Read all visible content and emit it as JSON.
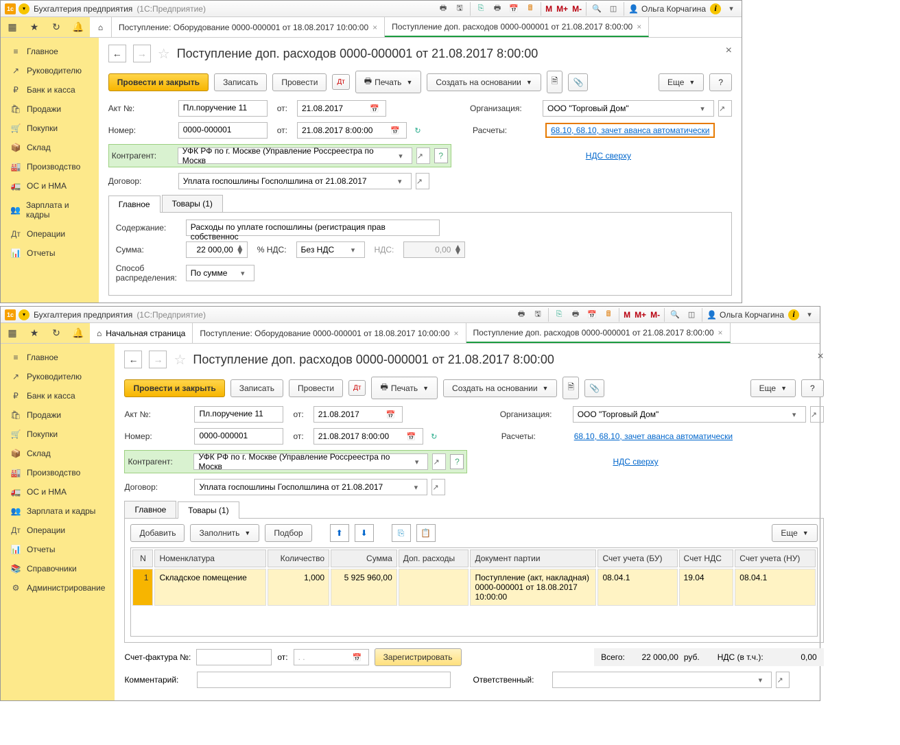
{
  "app": {
    "title": "Бухгалтерия предприятия",
    "subtitle": "(1С:Предприятие)",
    "user": "Ольга Корчагина"
  },
  "sidebar": {
    "items": [
      {
        "icon": "≡",
        "label": "Главное"
      },
      {
        "icon": "↗",
        "label": "Руководителю"
      },
      {
        "icon": "₽",
        "label": "Банк и касса"
      },
      {
        "icon": "🛍",
        "label": "Продажи"
      },
      {
        "icon": "🛒",
        "label": "Покупки"
      },
      {
        "icon": "📦",
        "label": "Склад"
      },
      {
        "icon": "🏭",
        "label": "Производство"
      },
      {
        "icon": "🚛",
        "label": "ОС и НМА"
      },
      {
        "icon": "👥",
        "label": "Зарплата и кадры"
      },
      {
        "icon": "Дт",
        "label": "Операции"
      },
      {
        "icon": "📊",
        "label": "Отчеты"
      },
      {
        "icon": "📚",
        "label": "Справочники"
      },
      {
        "icon": "⚙",
        "label": "Администрирование"
      }
    ]
  },
  "tabs": {
    "home": "Начальная страница",
    "t1": "Поступление: Оборудование 0000-000001 от 18.08.2017 10:00:00",
    "t2": "Поступление доп. расходов 0000-000001 от 21.08.2017 8:00:00"
  },
  "page": {
    "title": "Поступление доп. расходов 0000-000001 от 21.08.2017 8:00:00"
  },
  "toolbar": {
    "post_close": "Провести и закрыть",
    "write": "Записать",
    "post": "Провести",
    "print": "Печать",
    "create_based": "Создать на основании",
    "more": "Еще",
    "help": "?"
  },
  "fields": {
    "act_lbl": "Акт №:",
    "act_val": "Пл.поручение 11",
    "from_lbl": "от:",
    "act_date": "21.08.2017",
    "num_lbl": "Номер:",
    "num_val": "0000-000001",
    "num_date": "21.08.2017  8:00:00",
    "org_lbl": "Организация:",
    "org_val": "ООО \"Торговый Дом\"",
    "calc_lbl": "Расчеты:",
    "calc_link": "68.10, 68.10, зачет аванса автоматически",
    "vat_link": "НДС сверху",
    "contr_lbl": "Контрагент:",
    "contr_val": "УФК РФ по г. Москве (Управление Россреестра по Москв",
    "dog_lbl": "Договор:",
    "dog_val": "Уплата госпошлины Госполшлина от 21.08.2017"
  },
  "inner_tabs": {
    "main": "Главное",
    "goods": "Товары (1)"
  },
  "main_panel": {
    "content_lbl": "Содержание:",
    "content_val": "Расходы по уплате госпошлины (регистрация прав собственнос",
    "sum_lbl": "Сумма:",
    "sum_val": "22 000,00",
    "vat_pct_lbl": "% НДС:",
    "vat_pct_val": "Без НДС",
    "vat_lbl": "НДС:",
    "vat_val": "0,00",
    "distr_lbl": "Способ распределения:",
    "distr_val": "По сумме"
  },
  "goods_panel": {
    "add": "Добавить",
    "fill": "Заполнить",
    "pick": "Подбор",
    "more": "Еще",
    "headers": {
      "n": "N",
      "nom": "Номенклатура",
      "qty": "Количество",
      "sum": "Сумма",
      "ext": "Доп. расходы",
      "doc": "Документ партии",
      "acc_bu": "Счет учета (БУ)",
      "acc_vat": "Счет НДС",
      "acc_nu": "Счет учета (НУ)"
    },
    "row": {
      "n": "1",
      "nom": "Складское помещение",
      "qty": "1,000",
      "sum": "5 925 960,00",
      "ext": "",
      "doc": "Поступление (акт, накладная) 0000-000001 от 18.08.2017 10:00:00",
      "acc_bu": "08.04.1",
      "acc_vat": "19.04",
      "acc_nu": "08.04.1"
    }
  },
  "footer": {
    "sf_lbl": "Счет-фактура №:",
    "from": "от:",
    "date_mask": ".  .",
    "reg": "Зарегистрировать",
    "total_lbl": "Всего:",
    "total_val": "22 000,00",
    "rub": "руб.",
    "vat_incl": "НДС (в т.ч.):",
    "vat_val": "0,00",
    "comment_lbl": "Комментарий:",
    "resp_lbl": "Ответственный:"
  }
}
